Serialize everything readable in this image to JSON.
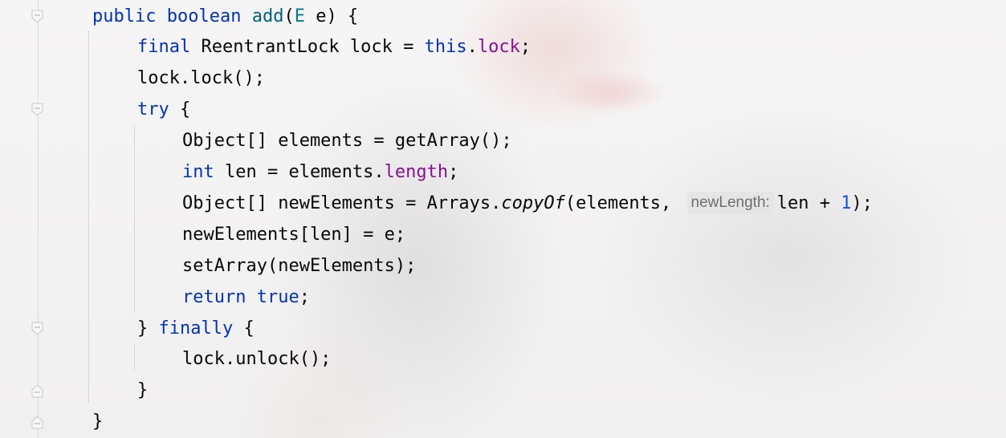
{
  "editor": {
    "lines": [
      {
        "parts": [
          {
            "t": "public",
            "c": "kw"
          },
          {
            "t": " "
          },
          {
            "t": "boolean",
            "c": "kw"
          },
          {
            "t": " "
          },
          {
            "t": "add",
            "c": "fn"
          },
          {
            "t": "("
          },
          {
            "t": "E",
            "c": "tp"
          },
          {
            "t": " e) {"
          }
        ]
      },
      {
        "parts": [
          {
            "t": "final",
            "c": "kw"
          },
          {
            "t": " ReentrantLock lock = "
          },
          {
            "t": "this",
            "c": "kw"
          },
          {
            "t": "."
          },
          {
            "t": "lock",
            "c": "fld"
          },
          {
            "t": ";"
          }
        ]
      },
      {
        "parts": [
          {
            "t": "lock.lock();"
          }
        ]
      },
      {
        "parts": [
          {
            "t": "try",
            "c": "kw"
          },
          {
            "t": " {"
          }
        ]
      },
      {
        "parts": [
          {
            "t": "Object[] elements = getArray();"
          }
        ]
      },
      {
        "parts": [
          {
            "t": "int",
            "c": "kw"
          },
          {
            "t": " len = elements."
          },
          {
            "t": "length",
            "c": "fld"
          },
          {
            "t": ";"
          }
        ]
      },
      {
        "parts": [
          {
            "t": "Object[] newElements = Arrays."
          },
          {
            "t": "copyOf",
            "c": "it"
          },
          {
            "t": "(elements, "
          },
          {
            "t": "newLength:",
            "c": "hint"
          },
          {
            "t": "len + "
          },
          {
            "t": "1",
            "c": "num"
          },
          {
            "t": ");"
          }
        ]
      },
      {
        "parts": [
          {
            "t": "newElements[len] = e;"
          }
        ]
      },
      {
        "parts": [
          {
            "t": "setArray(newElements);"
          }
        ]
      },
      {
        "parts": [
          {
            "t": "return",
            "c": "kw"
          },
          {
            "t": " "
          },
          {
            "t": "true",
            "c": "kw"
          },
          {
            "t": ";"
          }
        ]
      },
      {
        "parts": [
          {
            "t": "} "
          },
          {
            "t": "finally",
            "c": "kw"
          },
          {
            "t": " {"
          }
        ]
      },
      {
        "parts": [
          {
            "t": "lock.unlock();"
          }
        ]
      },
      {
        "parts": [
          {
            "t": "}"
          }
        ]
      },
      {
        "parts": [
          {
            "t": "}"
          }
        ]
      }
    ],
    "indent": [
      0,
      1,
      1,
      1,
      2,
      2,
      2,
      2,
      2,
      2,
      1,
      2,
      1,
      0
    ]
  },
  "gutter": {
    "fold_markers": [
      {
        "line": 0,
        "icon": "fold-open-icon"
      },
      {
        "line": 3,
        "icon": "fold-open-icon"
      },
      {
        "line": 10,
        "icon": "fold-open-icon"
      },
      {
        "line": 12,
        "icon": "fold-close-icon"
      },
      {
        "line": 13,
        "icon": "fold-close-icon"
      }
    ]
  },
  "colors": {
    "keyword": "#0033b3",
    "method": "#00627a",
    "type_param": "#007e8a",
    "field": "#871094",
    "number": "#1750eb",
    "text": "#080808",
    "hint_bg": "#e5e5e5",
    "hint_text": "#6f6f6f"
  }
}
